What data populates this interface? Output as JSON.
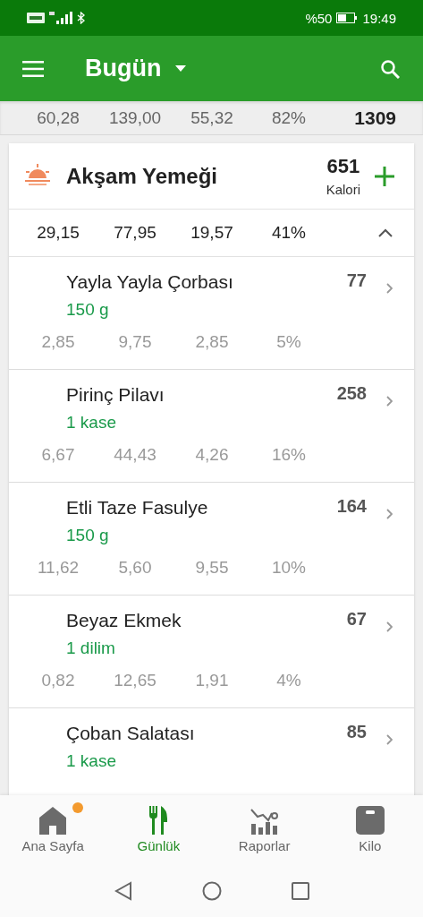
{
  "status_bar": {
    "battery": "%50",
    "time": "19:49"
  },
  "app_bar": {
    "title": "Bugün"
  },
  "day_summary": {
    "values": [
      "60,28",
      "139,00",
      "55,32",
      "82%"
    ],
    "calories": "1309"
  },
  "meal": {
    "title": "Akşam Yemeği",
    "calories": "651",
    "calories_label": "Kalori",
    "totals": [
      "29,15",
      "77,95",
      "19,57",
      "41%"
    ],
    "expanded": true,
    "items": [
      {
        "name": "Yayla Yayla Çorbası",
        "calories": "77",
        "quantity": "150  g",
        "macros": [
          "2,85",
          "9,75",
          "2,85",
          "5%"
        ]
      },
      {
        "name": "Pirinç Pilavı",
        "calories": "258",
        "quantity": "1  kase",
        "macros": [
          "6,67",
          "44,43",
          "4,26",
          "16%"
        ]
      },
      {
        "name": "Etli Taze Fasulye",
        "calories": "164",
        "quantity": "150  g",
        "macros": [
          "11,62",
          "5,60",
          "9,55",
          "10%"
        ]
      },
      {
        "name": "Beyaz Ekmek",
        "calories": "67",
        "quantity": "1  dilim",
        "macros": [
          "0,82",
          "12,65",
          "1,91",
          "4%"
        ]
      },
      {
        "name": "Çoban Salatası",
        "calories": "85",
        "quantity": "1  kase"
      }
    ]
  },
  "bottom_nav": [
    {
      "label": "Ana Sayfa",
      "kind": "home",
      "selected": false,
      "badge": true
    },
    {
      "label": "Günlük",
      "kind": "diary",
      "selected": true,
      "badge": false
    },
    {
      "label": "Raporlar",
      "kind": "reports",
      "selected": false,
      "badge": false
    },
    {
      "label": "Kilo",
      "kind": "weight",
      "selected": false,
      "badge": false
    }
  ]
}
